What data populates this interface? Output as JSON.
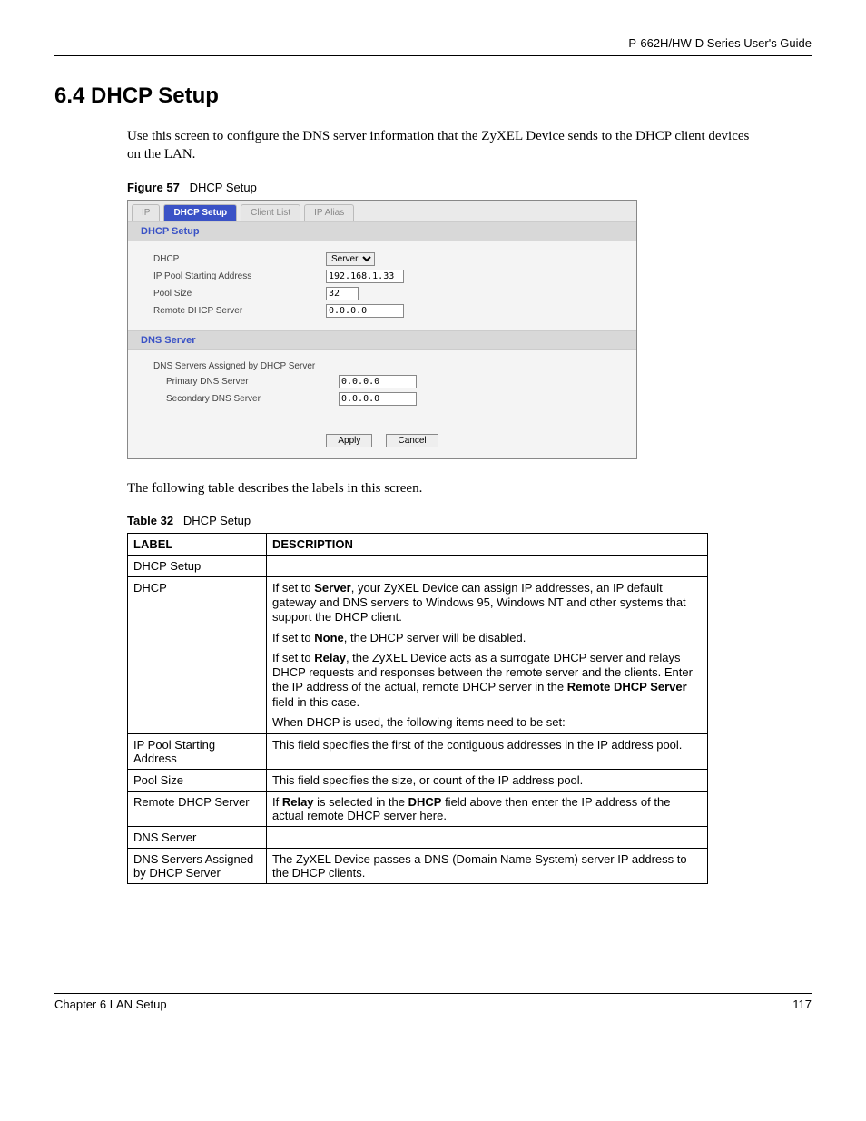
{
  "guide_title": "P-662H/HW-D Series User's Guide",
  "section_number_title": "6.4  DHCP Setup",
  "intro_paragraph": "Use this screen to configure the DNS server information that the ZyXEL Device sends to the DHCP client devices on the LAN.",
  "figure_label": "Figure 57",
  "figure_title": "DHCP Setup",
  "ui": {
    "tabs": [
      "IP",
      "DHCP Setup",
      "Client List",
      "IP Alias"
    ],
    "active_tab_index": 1,
    "section1_title": "DHCP Setup",
    "rows1": {
      "dhcp_label": "DHCP",
      "dhcp_value": "Server",
      "start_label": "IP Pool Starting Address",
      "start_value": "192.168.1.33",
      "pool_label": "Pool Size",
      "pool_value": "32",
      "remote_label": "Remote DHCP Server",
      "remote_value": "0.0.0.0"
    },
    "section2_title": "DNS Server",
    "rows2": {
      "assigned_label": "DNS Servers Assigned by DHCP Server",
      "primary_label": "Primary DNS Server",
      "primary_value": "0.0.0.0",
      "secondary_label": "Secondary DNS Server",
      "secondary_value": "0.0.0.0"
    },
    "apply": "Apply",
    "cancel": "Cancel"
  },
  "after_figure_para": "The following table describes the labels in this screen.",
  "table_label": "Table 32",
  "table_title": "DHCP Setup",
  "th_label": "LABEL",
  "th_desc": "DESCRIPTION",
  "rows": {
    "r1_label": "DHCP Setup",
    "r1_desc": "",
    "r2_label": "DHCP",
    "r2_p1a": "If set to ",
    "r2_p1b": "Server",
    "r2_p1c": ", your ZyXEL Device can assign IP addresses, an IP default gateway and DNS servers to Windows 95, Windows NT and other systems that support the DHCP client.",
    "r2_p2a": "If set to ",
    "r2_p2b": "None",
    "r2_p2c": ", the DHCP server will be disabled.",
    "r2_p3a": "If set to ",
    "r2_p3b": "Relay",
    "r2_p3c": ", the ZyXEL Device acts as a surrogate DHCP server and relays DHCP requests and responses between the remote server and the clients. Enter the IP address of the actual, remote DHCP server in the ",
    "r2_p3d": "Remote DHCP Server",
    "r2_p3e": " field in this case.",
    "r2_p4": "When DHCP is used, the following items need to be set:",
    "r3_label": "IP Pool Starting Address",
    "r3_desc": "This field specifies the first of the contiguous addresses in the IP address pool.",
    "r4_label": "Pool Size",
    "r4_desc": "This field specifies the size, or count of the IP address pool.",
    "r5_label": "Remote DHCP Server",
    "r5_desc_a": "If ",
    "r5_desc_b": "Relay",
    "r5_desc_c": " is selected in the ",
    "r5_desc_d": "DHCP",
    "r5_desc_e": " field above then enter the IP address of the actual remote DHCP server here.",
    "r6_label": "DNS Server",
    "r6_desc": "",
    "r7_label": "DNS Servers Assigned by DHCP Server",
    "r7_desc": "The ZyXEL Device passes a DNS (Domain Name System) server IP address to the DHCP clients."
  },
  "footer_left": "Chapter 6 LAN Setup",
  "footer_right": "117"
}
